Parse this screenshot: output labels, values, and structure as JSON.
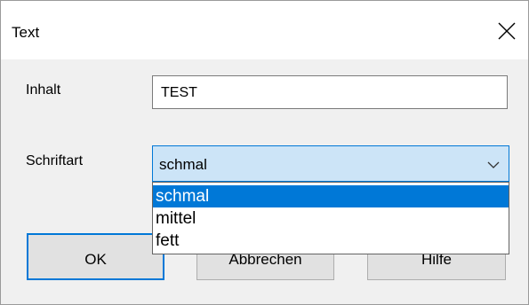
{
  "window": {
    "title": "Text"
  },
  "fields": {
    "content_label": "Inhalt",
    "content_value": "TEST",
    "font_label": "Schriftart",
    "font_selected": "schmal",
    "font_options": [
      "schmal",
      "mittel",
      "fett"
    ]
  },
  "buttons": {
    "ok": "OK",
    "cancel": "Abbrechen",
    "help": "Hilfe"
  },
  "icons": {
    "close": "close-icon",
    "dropdown": "chevron-down-icon"
  },
  "colors": {
    "accent": "#0078d7",
    "combo_bg": "#cce4f7",
    "dialog_bg": "#f0f0f0"
  }
}
